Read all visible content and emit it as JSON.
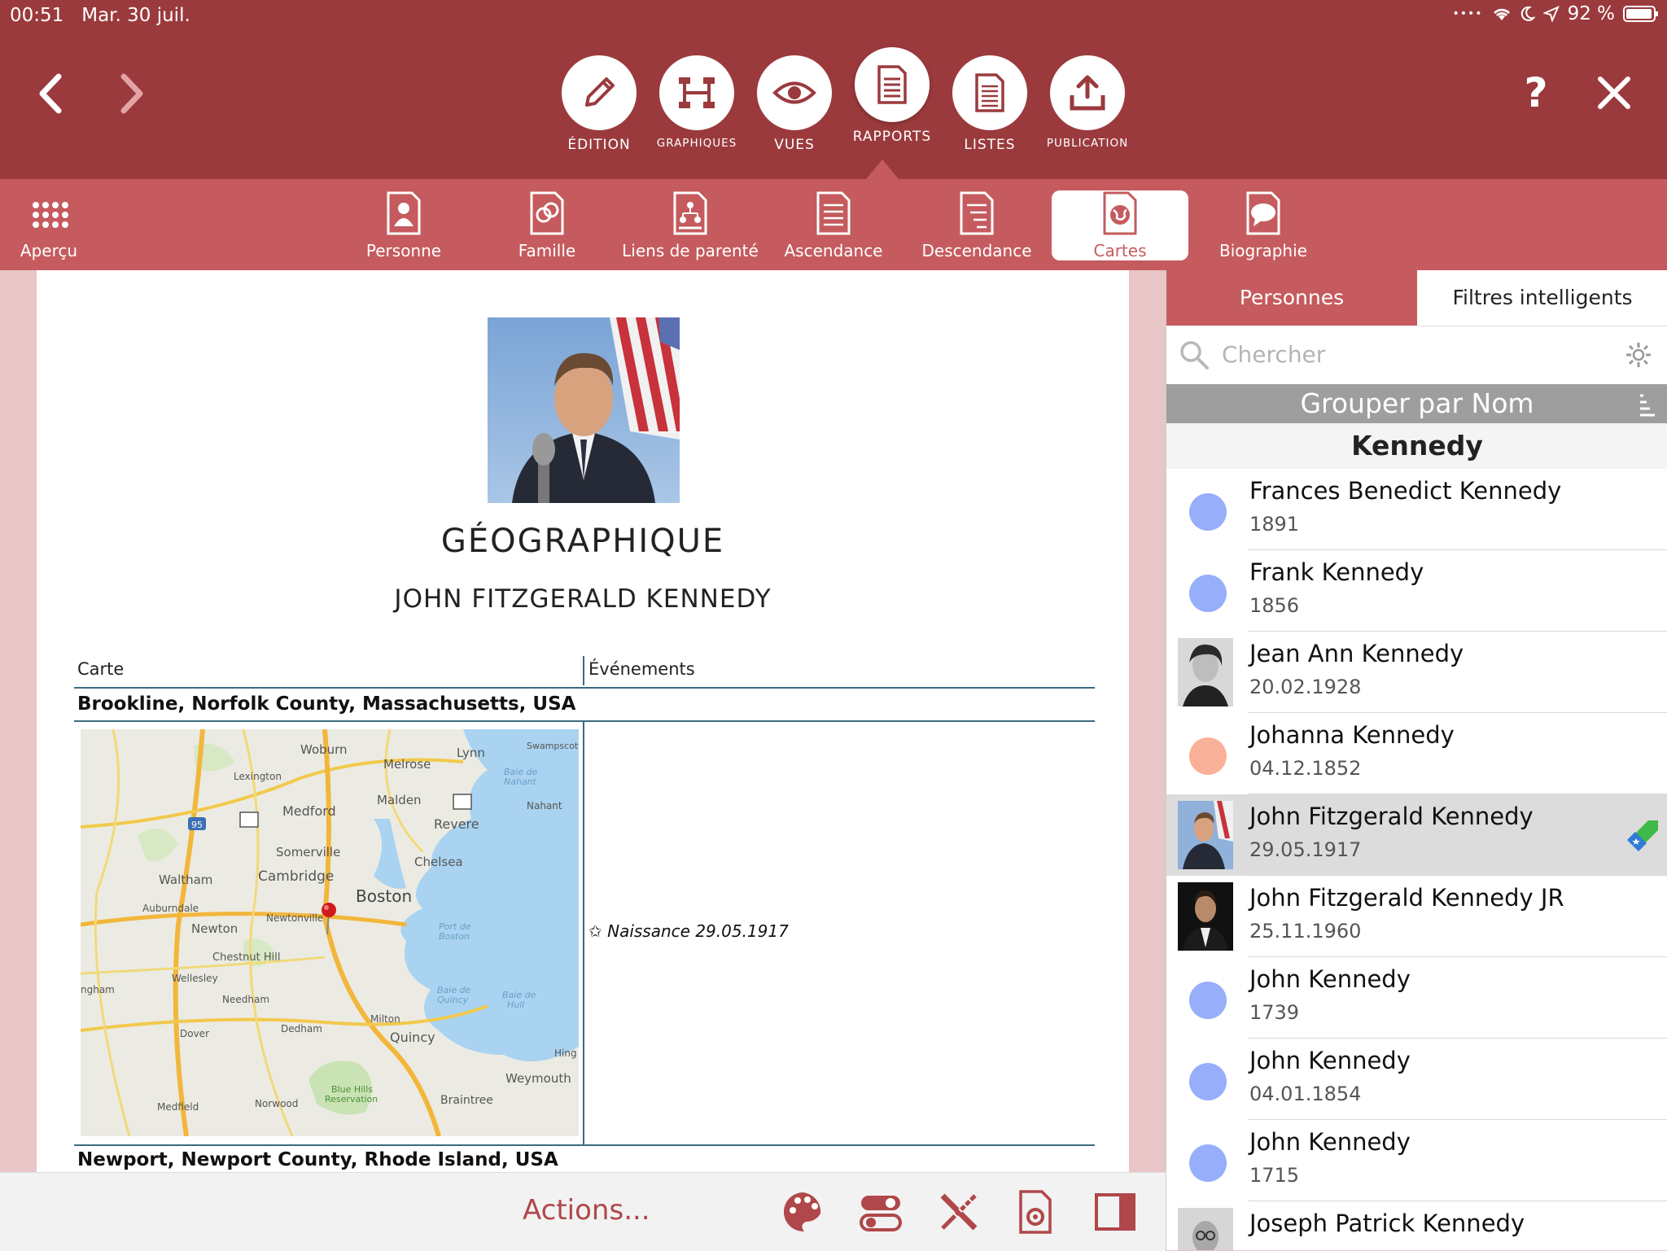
{
  "status": {
    "time": "00:51",
    "date": "Mar. 30 juil.",
    "battery": "92 %"
  },
  "toolbar": {
    "tools": [
      {
        "label": "ÉDITION",
        "icon": "pencil-icon"
      },
      {
        "label": "GRAPHIQUES",
        "icon": "chart-tree-icon"
      },
      {
        "label": "VUES",
        "icon": "eye-icon"
      },
      {
        "label": "RAPPORTS",
        "icon": "report-icon"
      },
      {
        "label": "LISTES",
        "icon": "list-icon"
      },
      {
        "label": "PUBLICATION",
        "icon": "upload-icon"
      }
    ],
    "help": "?"
  },
  "subbar": {
    "overview": "Aperçu",
    "items": [
      "Personne",
      "Famille",
      "Liens de parenté",
      "Ascendance",
      "Descendance",
      "Cartes",
      "Biographie"
    ],
    "active": "Cartes"
  },
  "document": {
    "title": "GÉOGRAPHIQUE",
    "subtitle": "JOHN FITZGERALD KENNEDY",
    "col_map": "Carte",
    "col_events": "Événements",
    "place1": "Brookline, Norfolk County, Massachusetts, USA",
    "event1": "✩ Naissance 29.05.1917",
    "place2": "Newport, Newport County, Rhode Island, USA",
    "map_labels": [
      "Woburn",
      "Lynn",
      "Swampscott",
      "Lexington",
      "Melrose",
      "Baie de Nahant",
      "Malden",
      "1A",
      "Nahant",
      "95",
      "2",
      "Medford",
      "Revere",
      "Somerville",
      "Chelsea",
      "Waltham",
      "Cambridge",
      "Boston",
      "Auburndale",
      "Newtonville",
      "Newton",
      "Port de Boston",
      "Chestnut Hill",
      "Wellesley",
      "Needham",
      "Baie de Quincy",
      "Baie de Hull",
      "Milton",
      "Dedham",
      "Quincy",
      "Dover",
      "Hing",
      "Weymouth",
      "Blue Hills Reservation",
      "Medfield",
      "Norwood",
      "Braintree"
    ]
  },
  "actions": {
    "label": "Actions..."
  },
  "panel": {
    "tab_persons": "Personnes",
    "tab_filters": "Filtres intelligents",
    "search_placeholder": "Chercher",
    "group_by": "Grouper par Nom",
    "section": "Kennedy",
    "people": [
      {
        "name": "Frances Benedict Kennedy",
        "date": "1891",
        "avatar": "#97aefb"
      },
      {
        "name": "Frank Kennedy",
        "date": "1856",
        "avatar": "#97aefb"
      },
      {
        "name": "Jean Ann Kennedy",
        "date": "20.02.1928",
        "avatar": "photo"
      },
      {
        "name": "Johanna Kennedy",
        "date": "04.12.1852",
        "avatar": "#f9b099"
      },
      {
        "name": "John Fitzgerald Kennedy",
        "date": "29.05.1917",
        "avatar": "photo",
        "selected": true
      },
      {
        "name": "John Fitzgerald Kennedy JR",
        "date": "25.11.1960",
        "avatar": "photo"
      },
      {
        "name": "John Kennedy",
        "date": "1739",
        "avatar": "#97aefb"
      },
      {
        "name": "John Kennedy",
        "date": "04.01.1854",
        "avatar": "#97aefb"
      },
      {
        "name": "John Kennedy",
        "date": "1715",
        "avatar": "#97aefb"
      },
      {
        "name": "Joseph Patrick Kennedy",
        "date": "",
        "avatar": "photo"
      }
    ]
  },
  "colors": {
    "header": "#9b3a3d",
    "subbar": "#c55b5e",
    "accent": "#b0474a",
    "male": "#97aefb",
    "female": "#f9b099"
  }
}
